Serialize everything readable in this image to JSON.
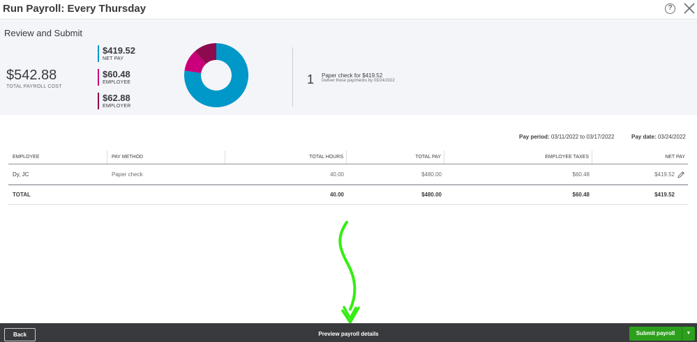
{
  "header": {
    "title": "Run Payroll: Every Thursday",
    "help_icon": "?"
  },
  "summary": {
    "section_title": "Review and Submit",
    "total_amount": "$542.88",
    "total_label": "TOTAL PAYROLL COST",
    "legend": [
      {
        "amount": "$419.52",
        "label": "NET PAY",
        "color": "#0097c9"
      },
      {
        "amount": "$60.48",
        "label": "EMPLOYEE",
        "color": "#c9007a"
      },
      {
        "amount": "$62.88",
        "label": "EMPLOYER",
        "color": "#8d0a4f"
      }
    ],
    "donut": [
      {
        "name": "NET PAY",
        "value": 419.52,
        "color": "#0097c9"
      },
      {
        "name": "EMPLOYEE",
        "value": 60.48,
        "color": "#c9007a"
      },
      {
        "name": "EMPLOYER",
        "value": 62.88,
        "color": "#8d0a4f"
      }
    ],
    "check_count": "1",
    "check_desc": "Paper check for $419.52",
    "check_sub": "Deliver these paychecks by 03/24/2022"
  },
  "period": {
    "pay_period_label": "Pay period:",
    "pay_period_value": "03/11/2022 to 03/17/2022",
    "pay_date_label": "Pay date:",
    "pay_date_value": "03/24/2022"
  },
  "table": {
    "columns": [
      "EMPLOYEE",
      "PAY METHOD",
      "TOTAL HOURS",
      "TOTAL PAY",
      "EMPLOYEE TAXES",
      "NET PAY"
    ],
    "rows": [
      {
        "employee": "Dy, JC",
        "pay_method": "Paper check",
        "hours": "40.00",
        "total_pay": "$480.00",
        "taxes": "$60.48",
        "net_pay": "$419.52"
      }
    ],
    "total": {
      "label": "TOTAL",
      "hours": "40.00",
      "total_pay": "$480.00",
      "taxes": "$60.48",
      "net_pay": "$419.52"
    }
  },
  "footer": {
    "back_label": "Back",
    "preview_label": "Preview payroll details",
    "submit_label": "Submit payroll",
    "submit_color": "#2ca01c"
  },
  "annotation_color": "#33ee11"
}
